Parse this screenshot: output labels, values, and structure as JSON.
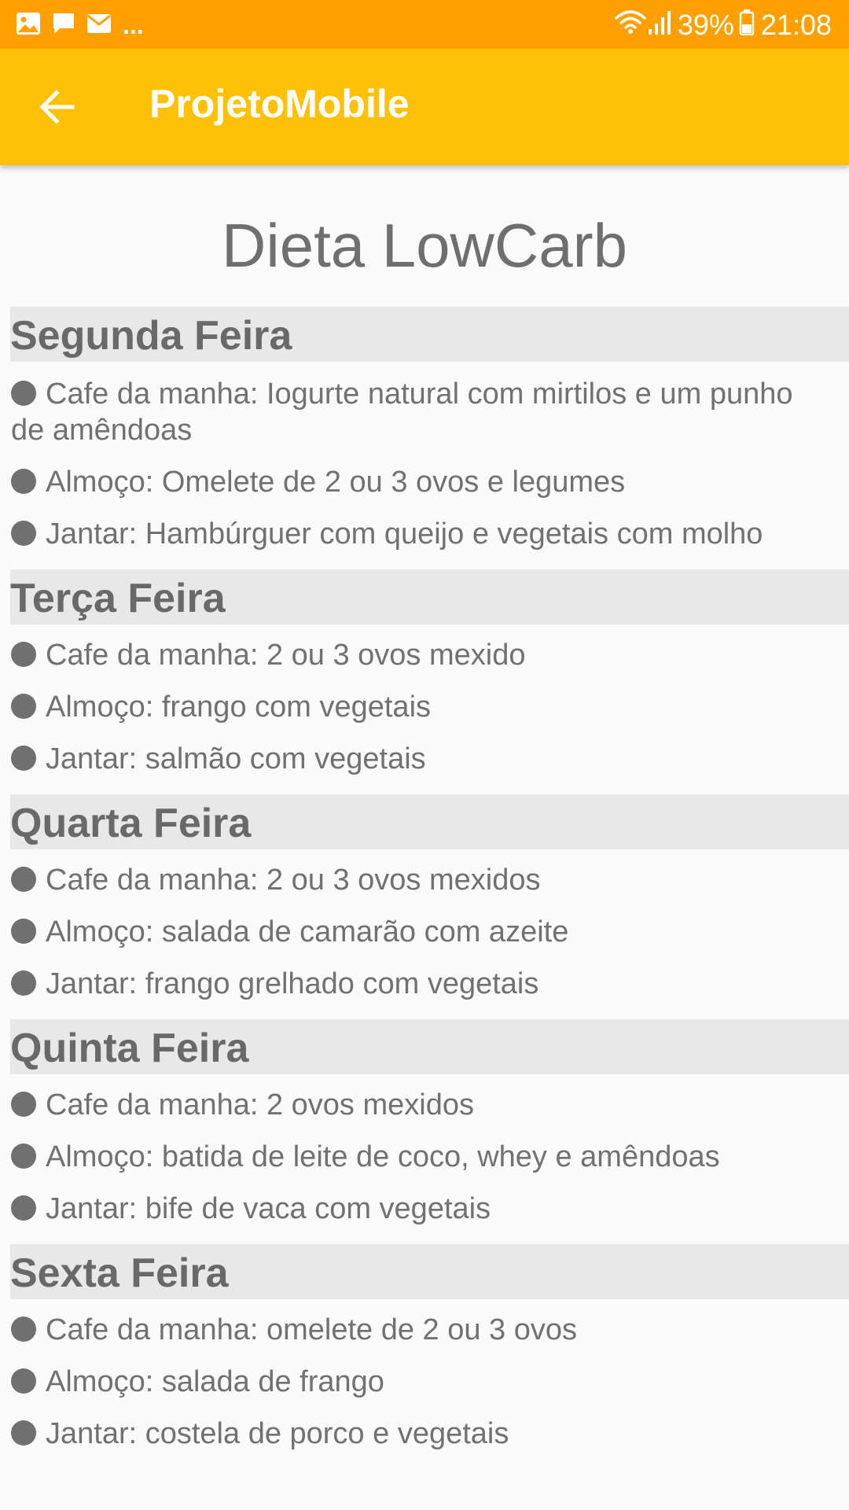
{
  "status_bar": {
    "battery": "39%",
    "time": "21:08",
    "overflow": "...",
    "icons": [
      "image-icon",
      "message-icon",
      "mail-icon",
      "wifi-icon",
      "signal-icon",
      "battery-icon"
    ]
  },
  "app_bar": {
    "title": "ProjetoMobile",
    "back_icon": "arrow-left-icon"
  },
  "page": {
    "title": "Dieta LowCarb"
  },
  "days": [
    {
      "name": "Segunda Feira",
      "meals": [
        "Cafe da manha: Iogurte natural com mirtilos e um punho de amêndoas",
        "Almoço: Omelete de 2 ou 3 ovos e legumes",
        "Jantar: Hambúrguer com queijo e vegetais com molho"
      ]
    },
    {
      "name": "Terça Feira",
      "meals": [
        "Cafe da manha: 2 ou 3 ovos mexido",
        "Almoço: frango com vegetais",
        "Jantar: salmão com vegetais"
      ]
    },
    {
      "name": "Quarta Feira",
      "meals": [
        "Cafe da manha: 2 ou 3 ovos mexidos",
        "Almoço: salada de camarão com azeite",
        "Jantar: frango grelhado com vegetais"
      ]
    },
    {
      "name": "Quinta Feira",
      "meals": [
        "Cafe da manha: 2 ovos mexidos",
        "Almoço: batida de leite de coco, whey e amêndoas",
        "Jantar: bife de vaca com vegetais"
      ]
    },
    {
      "name": "Sexta Feira",
      "meals": [
        "Cafe da manha: omelete de 2 ou 3 ovos",
        "Almoço: salada de frango",
        "Jantar: costela de porco e vegetais"
      ]
    }
  ],
  "colors": {
    "status_bar": "#ff9f00",
    "app_bar": "#ffc107",
    "background": "#fafafa",
    "day_header_bg": "#e8e8e8",
    "text": "#707070"
  }
}
